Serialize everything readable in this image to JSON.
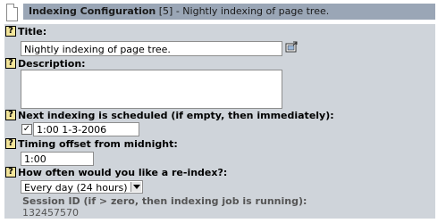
{
  "header": {
    "title": "Indexing Configuration",
    "record_id": "[5]",
    "record_title": "- Nightly indexing of page tree."
  },
  "fields": {
    "title": {
      "label": "Title:",
      "value": "Nightly indexing of page tree."
    },
    "description": {
      "label": "Description:",
      "value": ""
    },
    "next_indexing": {
      "label": "Next indexing is scheduled (if empty, then immediately):",
      "checkbox_checked": true,
      "value": "1:00 1-3-2006"
    },
    "timing_offset": {
      "label": "Timing offset from midnight:",
      "value": "1:00"
    },
    "reindex": {
      "label": "How often would you like a re-index?:",
      "selected": "Every day (24 hours)"
    },
    "session_id": {
      "label": "Session ID (if > zero, then indexing job is running):",
      "value": "132457570"
    }
  },
  "icons": {
    "help": "help-icon",
    "wizard": "wizard-icon",
    "checkmark": "✓"
  },
  "colors": {
    "header_bar": "#9aa6b6",
    "form_background": "#cfd4da",
    "help_icon_fill": "#f3e59a"
  }
}
